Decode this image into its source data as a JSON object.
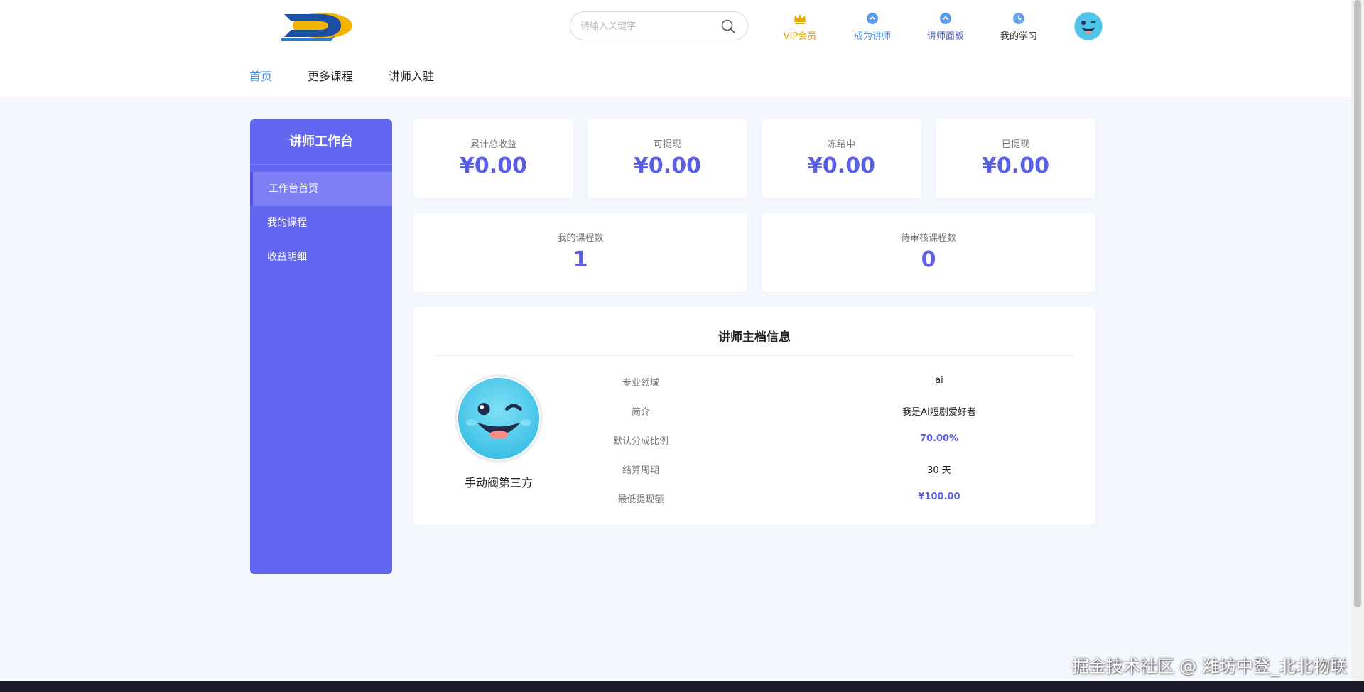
{
  "header": {
    "search": {
      "placeholder": "请输入关键字"
    },
    "nav": [
      {
        "label": "VIP会员",
        "icon": "crown-icon",
        "color": "#e6a800"
      },
      {
        "label": "成为讲师",
        "icon": "up-arrow-circle-icon",
        "color": "#4b90e2"
      },
      {
        "label": "讲师面板",
        "icon": "up-arrow-circle-icon",
        "color": "#4b60c8"
      },
      {
        "label": "我的学习",
        "icon": "clock-icon",
        "color": "#333333"
      }
    ],
    "menu": [
      {
        "label": "首页",
        "active": true
      },
      {
        "label": "更多课程"
      },
      {
        "label": "讲师入驻"
      }
    ]
  },
  "sidebar": {
    "title": "讲师工作台",
    "items": [
      {
        "label": "工作台首页",
        "active": true
      },
      {
        "label": "我的课程"
      },
      {
        "label": "收益明细"
      }
    ]
  },
  "stats": {
    "earnings": [
      {
        "label": "累计总收益",
        "value": "¥0.00"
      },
      {
        "label": "可提现",
        "value": "¥0.00"
      },
      {
        "label": "冻结中",
        "value": "¥0.00"
      },
      {
        "label": "已提现",
        "value": "¥0.00"
      }
    ],
    "courses": [
      {
        "label": "我的课程数",
        "value": "1"
      },
      {
        "label": "待审核课程数",
        "value": "0"
      }
    ]
  },
  "profile": {
    "title": "讲师主档信息",
    "name": "手动阀第三方",
    "rows": [
      {
        "key": "专业领域",
        "value": "ai"
      },
      {
        "key": "简介",
        "value": "我是AI短剧爱好者"
      },
      {
        "key": "默认分成比例",
        "value": "70.00%"
      },
      {
        "key": "结算周期",
        "value": "30 天"
      },
      {
        "key": "最低提现额",
        "value": "¥100.00"
      }
    ]
  },
  "watermark": "掘金技术社区 @ 潍坊中登_北北物联",
  "colors": {
    "accent": "#6366f1",
    "value": "#5b5fe4",
    "link": "#4b90e2",
    "background": "#f4f7fd"
  }
}
